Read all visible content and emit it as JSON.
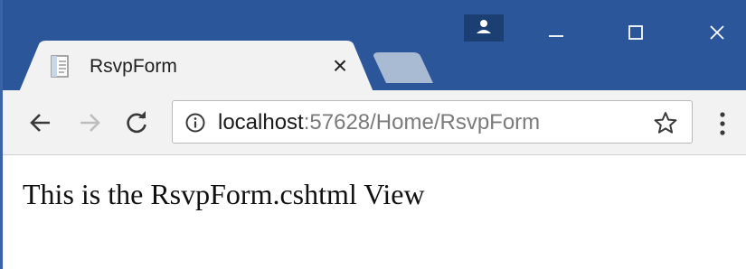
{
  "browser": {
    "tab": {
      "title": "RsvpForm",
      "close_glyph": "×",
      "favicon": "document-icon"
    },
    "window_controls": [
      "profile-icon",
      "minimize-icon",
      "maximize-icon",
      "close-icon"
    ],
    "colors": {
      "titlebar": "#2b579a",
      "toolbar": "#f2f2f2",
      "newtab": "#a9bad3"
    }
  },
  "toolbar": {
    "address": {
      "host": "localhost",
      "rest": ":57628/Home/RsvpForm"
    }
  },
  "page": {
    "heading": "This is the RsvpForm.cshtml View"
  }
}
